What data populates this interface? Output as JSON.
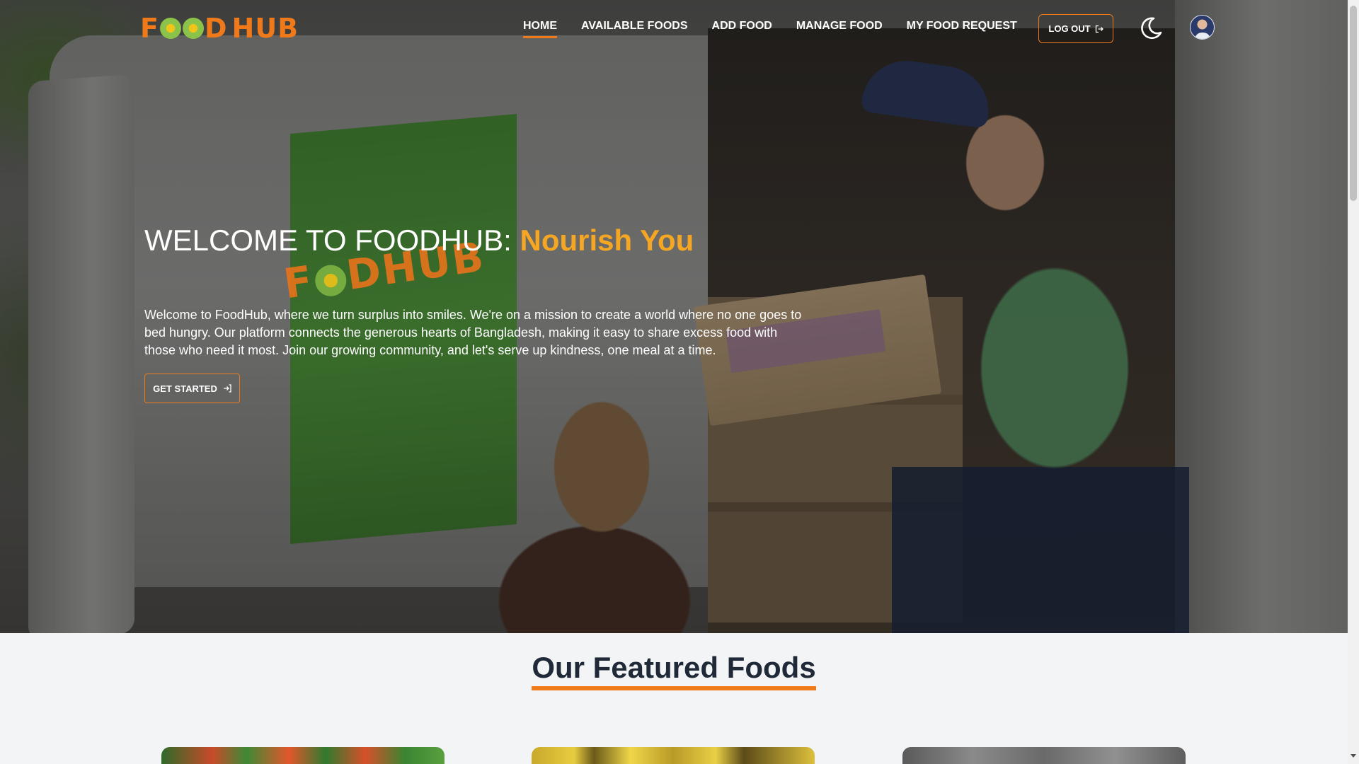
{
  "brand": {
    "logo_text_left": "F",
    "logo_text_right": "D",
    "logo_suffix": "HUB",
    "accent_color": "#f07a1a",
    "highlight_color": "#f5a623"
  },
  "nav": {
    "items": [
      {
        "label": "HOME",
        "active": true
      },
      {
        "label": "AVAILABLE FOODS",
        "active": false
      },
      {
        "label": "ADD FOOD",
        "active": false
      },
      {
        "label": "MANAGE FOOD",
        "active": false
      },
      {
        "label": "MY FOOD REQUEST",
        "active": false
      }
    ],
    "logout_label": "LOG OUT",
    "logout_icon": "logout-icon",
    "theme_icon": "moon-icon",
    "avatar_icon": "user-avatar"
  },
  "hero": {
    "title_main": "WELCOME TO FOODHUB: ",
    "title_accent": "Nourish You",
    "description": "Welcome to FoodHub, where we turn surplus into smiles. We're on a mission to create a world where no one goes to bed hungry. Our platform connects the generous hearts of Bangladesh, making it easy to share excess food with those who need it most. Join our growing community, and let's serve up kindness, one meal at a time.",
    "cta_label": "GET STARTED",
    "cta_icon": "arrow-in-icon"
  },
  "featured": {
    "title": "Our Featured Foods"
  }
}
